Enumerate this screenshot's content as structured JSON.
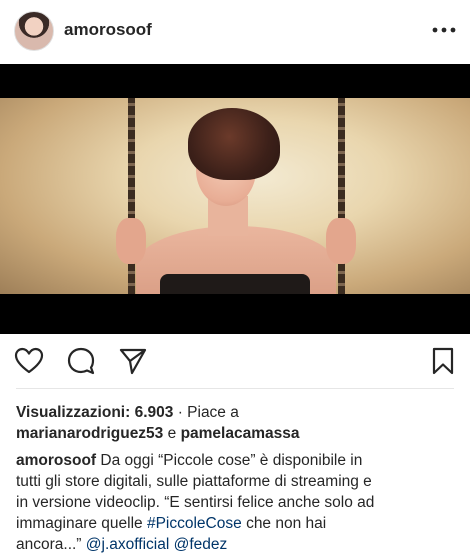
{
  "header": {
    "username": "amorosoof",
    "more_label": "•••"
  },
  "stats": {
    "views_label": "Visualizzazioni: 6.903",
    "likes_prefix": "· Piace a",
    "liker1": "marianarodriguez53",
    "conjunction": "e",
    "liker2": "pamelacamassa"
  },
  "caption": {
    "author": "amorosoof",
    "line1": "Da oggi “Piccole cose” è disponibile in",
    "line2": "tutti gli store digitali, sulle piattaforme di streaming e",
    "line3": "in versione videoclip. “E sentirsi felice anche solo ad",
    "line4_pre": "immaginare quelle",
    "hashtag": "#PiccoleCose",
    "line4_post": "che non hai",
    "line5_pre": "ancora...”",
    "mention1": "@j.axofficial",
    "mention2": "@fedez"
  },
  "icons": {
    "like": "heart-icon",
    "comment": "comment-icon",
    "share": "share-icon",
    "save": "bookmark-icon"
  }
}
